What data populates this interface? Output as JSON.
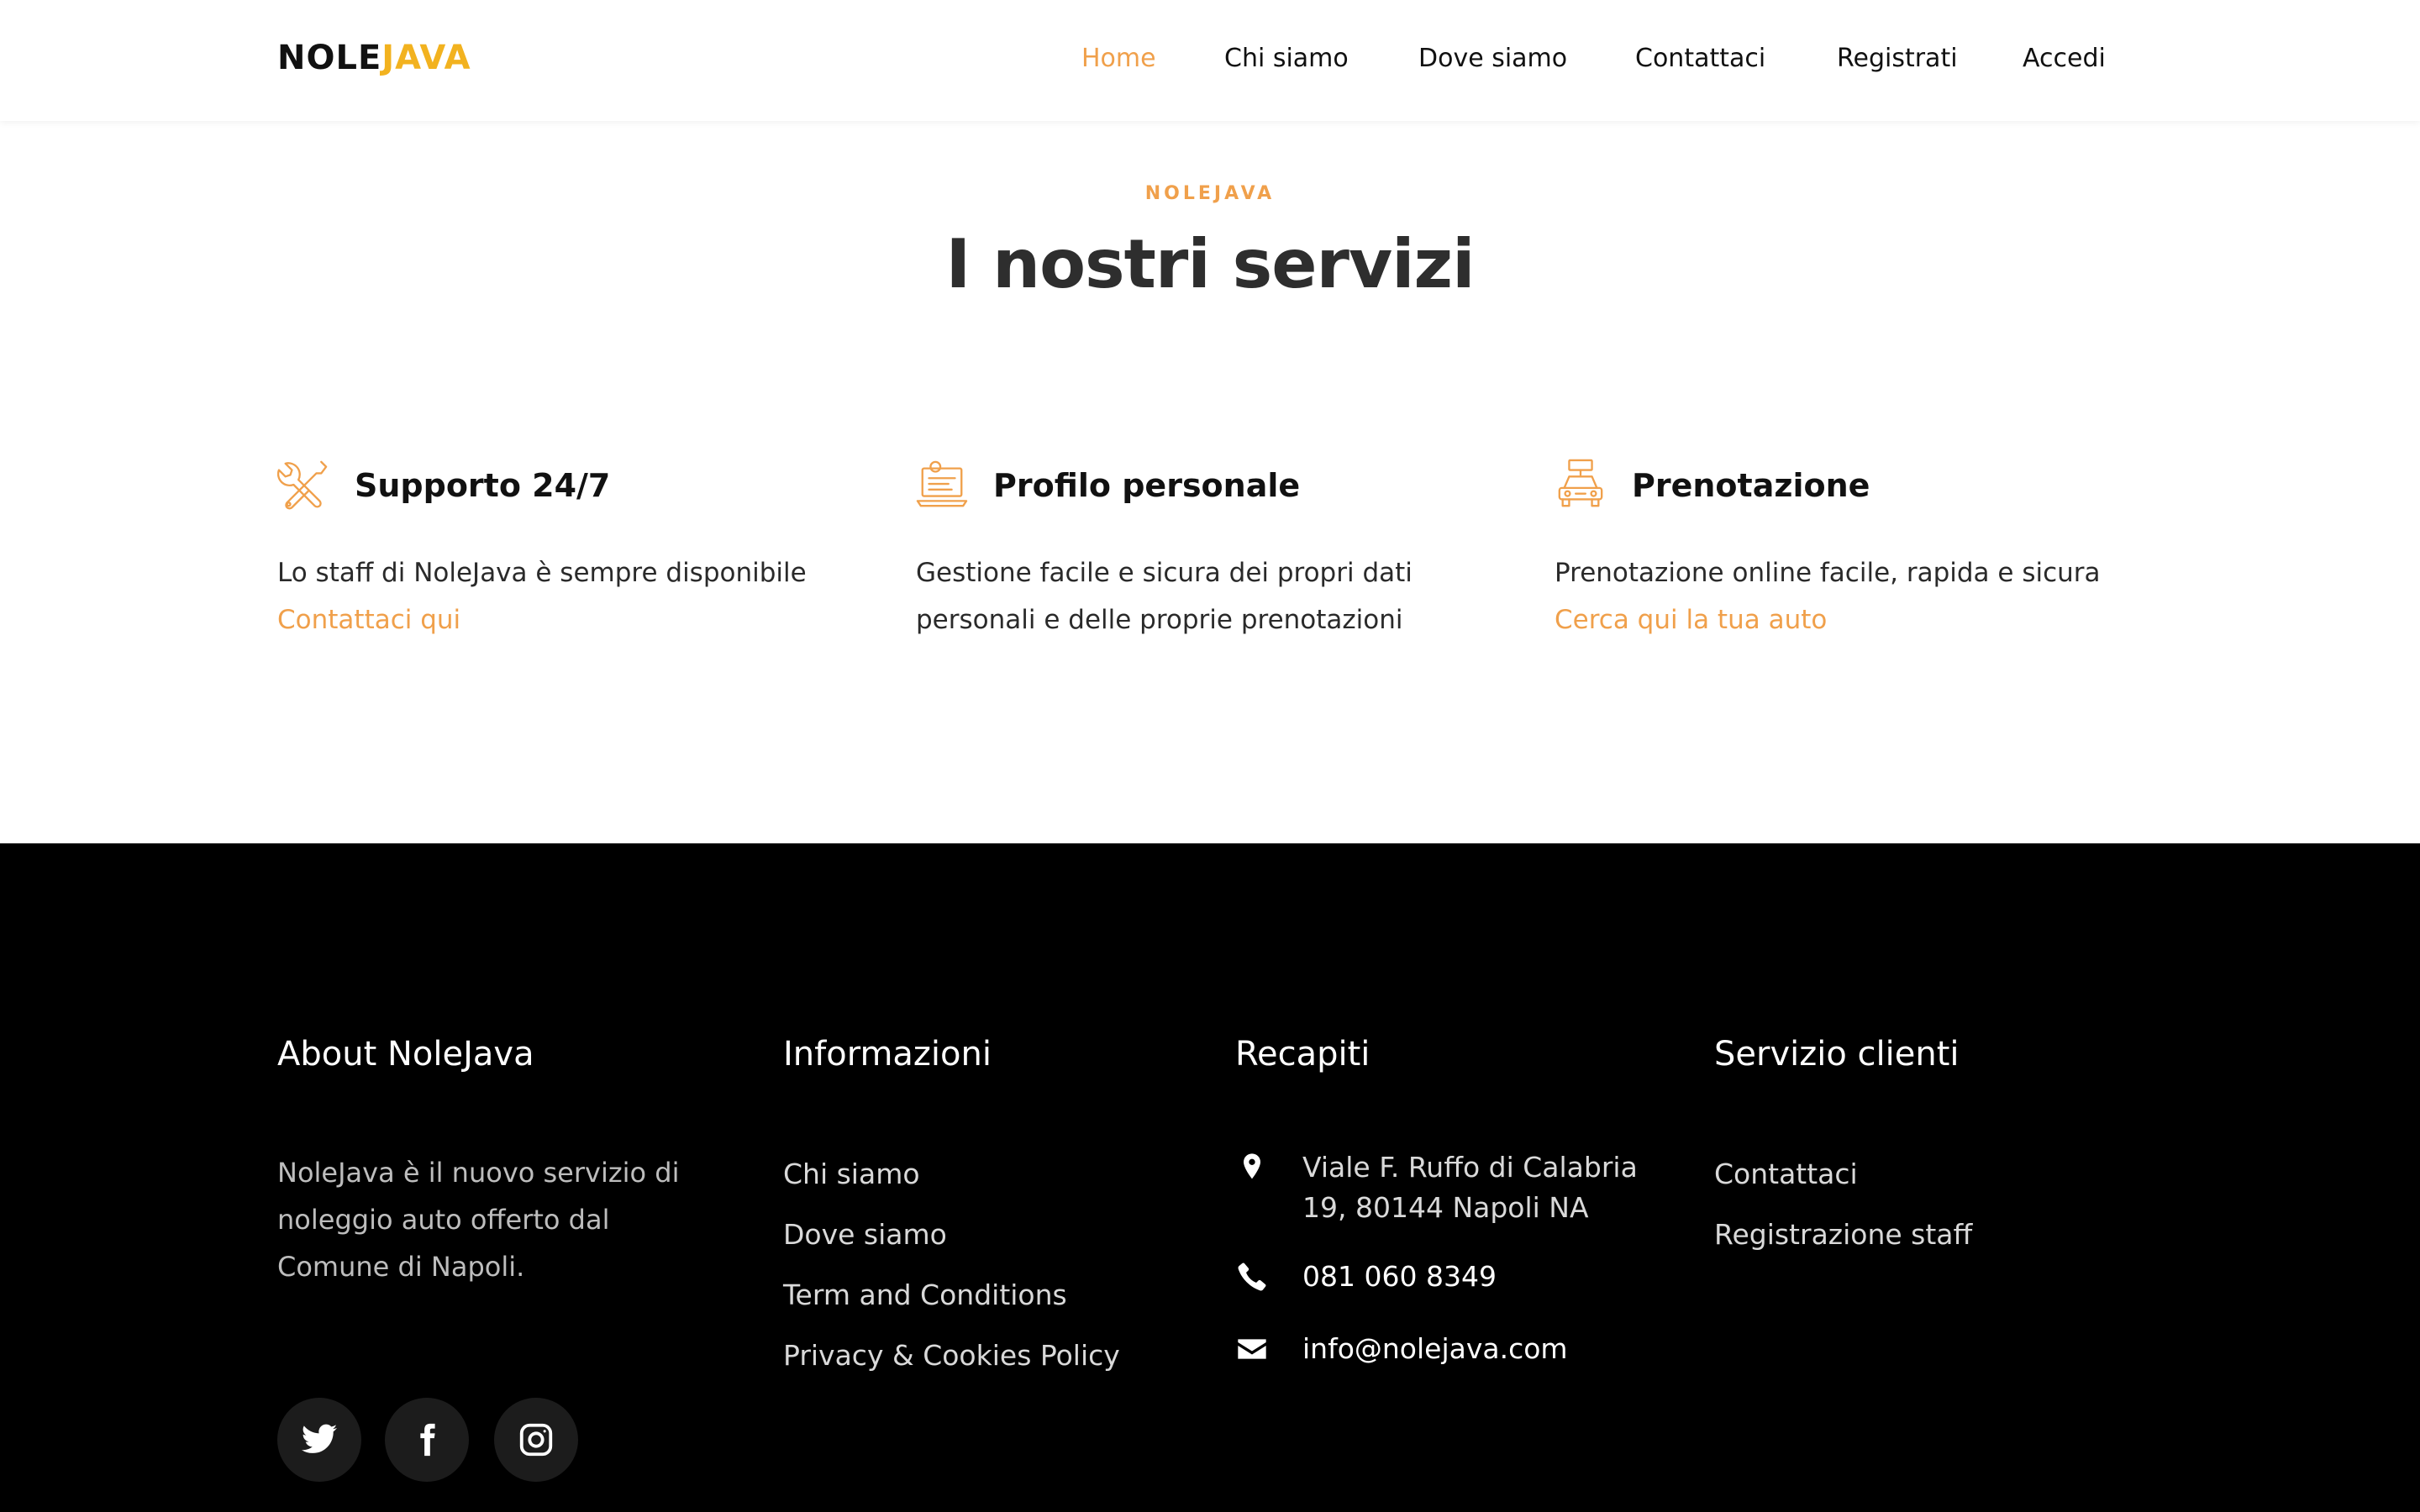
{
  "brand": {
    "part1": "NOLE",
    "part2": "JAVA",
    "accent_color": "#f2b21f"
  },
  "nav": {
    "items": [
      {
        "label": "Home",
        "active": true
      },
      {
        "label": "Chi siamo"
      },
      {
        "label": "Dove siamo"
      },
      {
        "label": "Contattaci"
      },
      {
        "label": "Registrati"
      },
      {
        "label": "Accedi"
      }
    ]
  },
  "services_section": {
    "kicker": "NOLEJAVA",
    "title": "I nostri servizi",
    "items": [
      {
        "icon": "tools-icon",
        "title": "Supporto 24/7",
        "text_lines": [
          "Lo staff di NoleJava è sempre disponibile"
        ],
        "link": "Contattaci qui"
      },
      {
        "icon": "profile-laptop-icon",
        "title": "Profilo personale",
        "text_lines": [
          "Gestione facile e sicura dei propri dati",
          "personali e delle proprie prenotazioni"
        ]
      },
      {
        "icon": "rent-car-icon",
        "title": "Prenotazione",
        "text_lines": [
          "Prenotazione online facile, rapida e sicura"
        ],
        "link": "Cerca qui la tua auto"
      }
    ]
  },
  "footer": {
    "about": {
      "heading": "About NoleJava",
      "text_lines": [
        "NoleJava è il nuovo servizio di",
        "noleggio auto offerto dal",
        "Comune di Napoli."
      ],
      "social": [
        "twitter-icon",
        "facebook-icon",
        "instagram-icon"
      ]
    },
    "info": {
      "heading": "Informazioni",
      "links": [
        "Chi siamo",
        "Dove siamo",
        "Term and Conditions",
        "Privacy & Cookies Policy"
      ]
    },
    "contacts": {
      "heading": "Recapiti",
      "address_lines": [
        "Viale F. Ruffo di Calabria",
        "19, 80144 Napoli NA"
      ],
      "phone": "081 060 8349",
      "email": "info@nolejava.com"
    },
    "customer_service": {
      "heading": "Servizio clienti",
      "links": [
        "Contattaci",
        "Registrazione staff"
      ]
    }
  },
  "colors": {
    "accent": "#f0a04b",
    "footer_bg": "#000000"
  }
}
